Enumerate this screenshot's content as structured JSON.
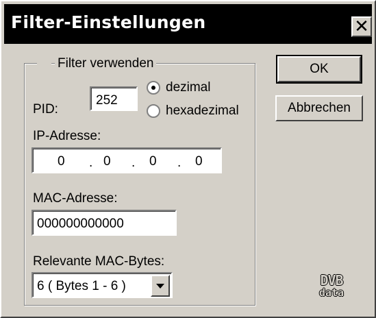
{
  "window": {
    "title": "Filter-Einstellungen",
    "close_glyph": "✕"
  },
  "filter_group": {
    "label": "Filter verwenden",
    "enabled": false
  },
  "pid": {
    "label": "PID:",
    "value": "252",
    "radio_decimal": "dezimal",
    "radio_hex": "hexadezimal",
    "selected": "dezimal"
  },
  "ip": {
    "label": "IP-Adresse:",
    "octets": [
      "0",
      "0",
      "0",
      "0"
    ],
    "separator": "."
  },
  "mac": {
    "label": "MAC-Adresse:",
    "value": "000000000000"
  },
  "mac_bytes": {
    "label": "Relevante MAC-Bytes:",
    "selected": "6  ( Bytes 1 - 6 )"
  },
  "buttons": {
    "ok": "OK",
    "cancel": "Abbrechen"
  },
  "logo": {
    "line1": "DVB",
    "line2": "data"
  },
  "colors": {
    "face": "#d4d0c8",
    "titlebar": "#000000"
  }
}
